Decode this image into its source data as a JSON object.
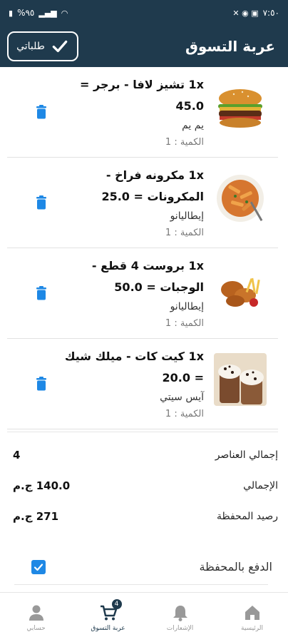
{
  "status_bar": {
    "time": "٧:٥٠",
    "battery": "%٩٥"
  },
  "header": {
    "title": "عربة التسوق",
    "orders_button_label": "طلباتي"
  },
  "cart_items": [
    {
      "title": "1x تشيز لافا - برجر = 45.0",
      "restaurant": "يم يم",
      "quantity": "الكمية : 1"
    },
    {
      "title": "1x مكرونه فراخ - المكرونات = 25.0",
      "restaurant": "إيطاليانو",
      "quantity": "الكمية : 1"
    },
    {
      "title": "1x بروست 4 قطع - الوجبات = 50.0",
      "restaurant": "إيطاليانو",
      "quantity": "الكمية : 1"
    },
    {
      "title": "1x كيت كات - ميلك شيك = 20.0",
      "restaurant": "آيس سيتي",
      "quantity": "الكمية : 1"
    }
  ],
  "summary": {
    "items_label": "إجمالي العناصر",
    "items_value": "4",
    "total_label": "الإجمالي",
    "total_value": "140.0 ج.م",
    "wallet_balance_label": "رصيد المحفظة",
    "wallet_balance_value": "271 ج.م"
  },
  "wallet_payment": {
    "label": "الدفع بالمحفظة",
    "checked": true
  },
  "bottom_nav": {
    "home": "الرئيسية",
    "notifications": "الإشعارات",
    "cart": "عربة التسوق",
    "cart_badge": "4",
    "account": "حسابي"
  },
  "colors": {
    "primary": "#1f3a4d",
    "accent": "#1e88e5"
  }
}
